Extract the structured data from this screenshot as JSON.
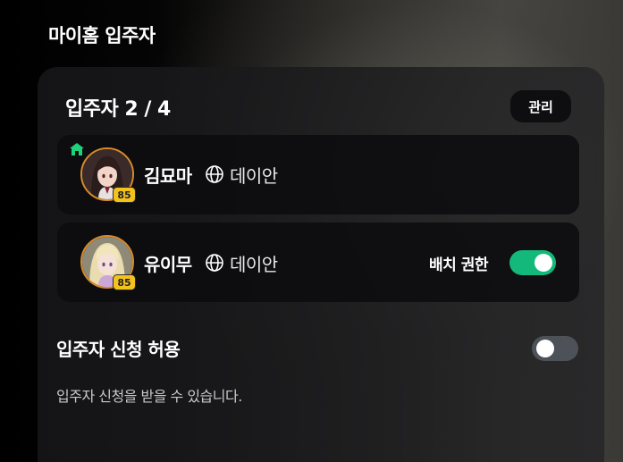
{
  "header": {
    "title": "마이홈 입주자"
  },
  "residents_section": {
    "title": "입주자 2 / 4",
    "manage_label": "관리",
    "residents": [
      {
        "name": "김묘마",
        "server": "데이안",
        "level": "85",
        "is_owner": true,
        "owner_icon": "home-icon",
        "server_icon": "globe-icon"
      },
      {
        "name": "유이무",
        "server": "데이안",
        "level": "85",
        "is_owner": false,
        "server_icon": "globe-icon",
        "permission_label": "배치 권한",
        "permission_enabled": true
      }
    ]
  },
  "application": {
    "label": "입주자 신청 허용",
    "enabled": false,
    "description": "입주자 신청을 받을 수 있습니다."
  },
  "colors": {
    "toggle_on": "#12b97b",
    "toggle_off": "#4d5258",
    "level_badge": "#f4c21c",
    "owner_icon": "#1fd17a",
    "avatar_ring": "#d98a2a"
  }
}
